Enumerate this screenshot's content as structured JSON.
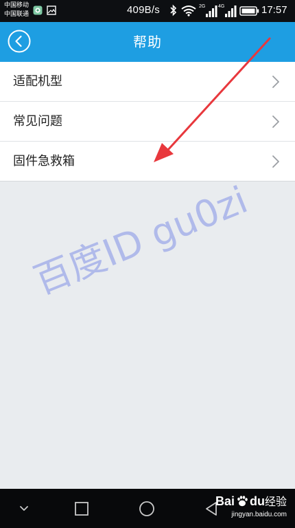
{
  "status_bar": {
    "carrier_1": "中国移动",
    "carrier_2": "中国联通",
    "net_speed": "409B/s",
    "net_2g": "2G",
    "net_4g": "4G",
    "time": "17:57"
  },
  "header": {
    "title": "帮助"
  },
  "menu": {
    "items": [
      {
        "label": "适配机型"
      },
      {
        "label": "常见问题"
      },
      {
        "label": "固件急救箱"
      }
    ]
  },
  "watermark": {
    "text": "百度ID gu0zi"
  },
  "branding": {
    "logo_bai": "Bai",
    "logo_du": "du",
    "logo_jingyan": "经验",
    "url": "jingyan.baidu.com"
  },
  "colors": {
    "header_bg": "#1e9ee2",
    "page_bg": "#e9ecef",
    "annotation_arrow": "#e8383d"
  },
  "icons": {
    "header_back": "back-circle-icon",
    "row_chevron": "chevron-right-icon",
    "nav_back": "nav-back-icon",
    "nav_home": "nav-home-icon",
    "nav_recents": "nav-recents-icon"
  }
}
